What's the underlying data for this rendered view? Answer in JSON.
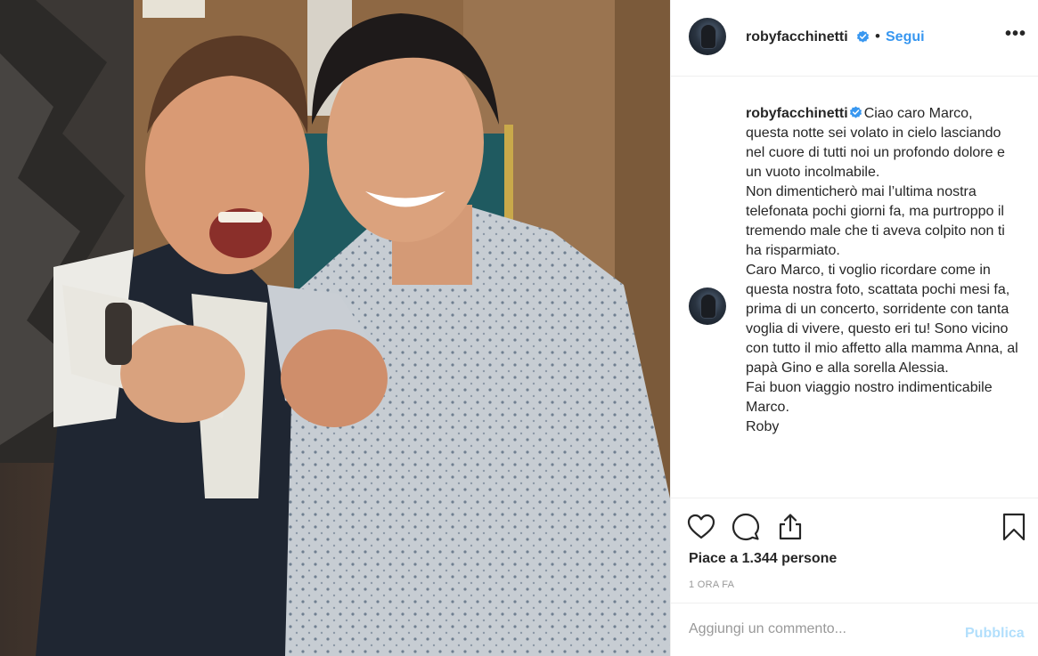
{
  "post": {
    "photo_alt": "Roby Facchinetti e Marco",
    "author": {
      "username": "robyfacchinetti",
      "verified": true,
      "avatar_icon": "profile-avatar"
    },
    "follow_label": "Segui",
    "separator": "•",
    "more_label": "•••",
    "caption": {
      "username": "robyfacchinetti",
      "text": "Ciao caro Marco,\nquesta notte sei volato in cielo lasciando nel cuore di tutti noi un profondo dolore e un vuoto incolmabile.\nNon dimenticherò mai l’ultima nostra telefonata pochi giorni fa, ma purtroppo il tremendo male che ti aveva colpito non ti ha risparmiato.\nCaro Marco, ti voglio ricordare come in questa nostra foto, scattata pochi mesi fa, prima di un concerto, sorridente con tanta voglia di vivere, questo eri tu! Sono vicino con tutto il mio affetto alla mamma Anna, al papà Gino e alla sorella Alessia.\nFai buon viaggio nostro indimenticabile Marco.\nRoby"
    },
    "actions": {
      "like_icon": "heart-icon",
      "comment_icon": "comment-icon",
      "share_icon": "share-icon",
      "save_icon": "bookmark-icon"
    },
    "likes_text": "Piace a 1.344 persone",
    "timestamp": "1 ORA FA",
    "comment_box": {
      "placeholder": "Aggiungi un commento...",
      "value": "",
      "publish_label": "Pubblica"
    },
    "colors": {
      "link_blue": "#3897f0",
      "publish_disabled": "#b2dffc",
      "verified_blue": "#3897f0",
      "border": "#efefef",
      "muted": "#999999"
    }
  }
}
